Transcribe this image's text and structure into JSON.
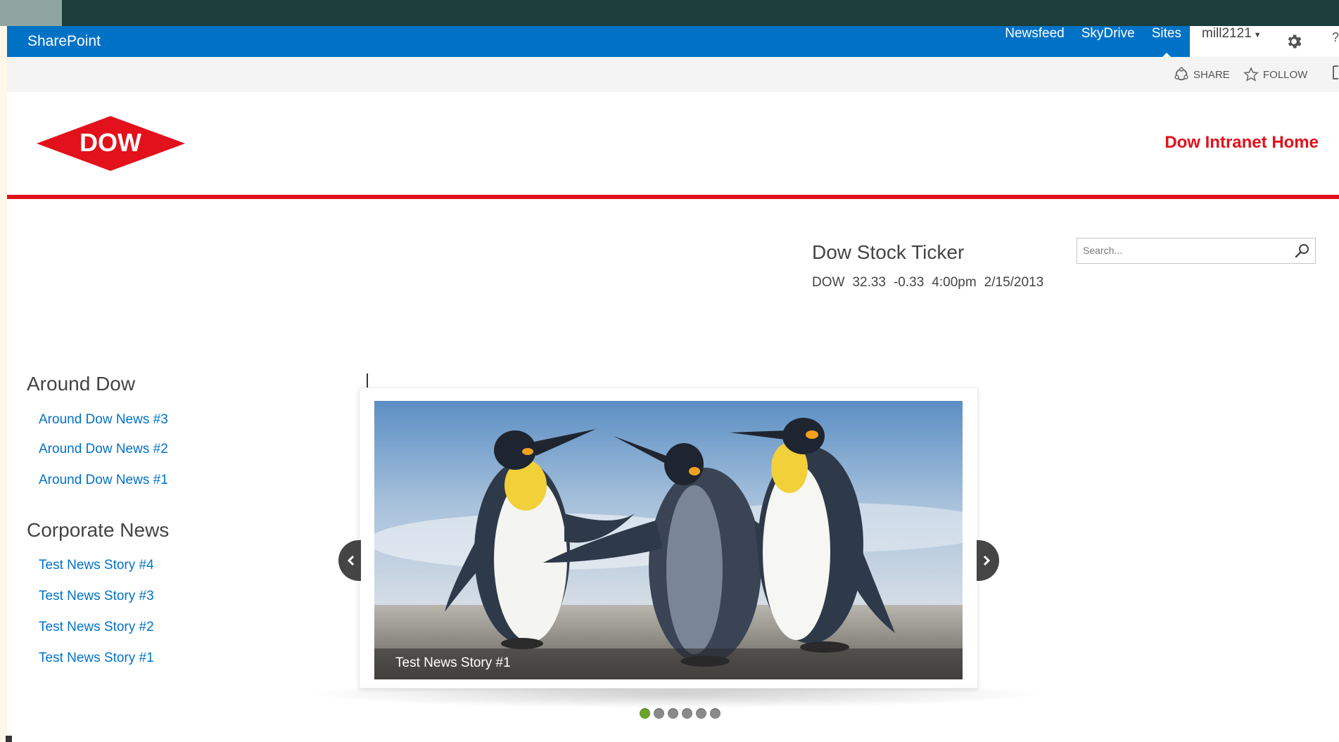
{
  "suite_bar": {
    "brand": "SharePoint",
    "links": [
      "Newsfeed",
      "SkyDrive",
      "Sites"
    ],
    "active_link": "Sites",
    "user": "mill2121",
    "bg_color": "#0072c6"
  },
  "ribbon": {
    "share_label": "SHARE",
    "follow_label": "FOLLOW"
  },
  "header": {
    "logo_text": "DOW",
    "logo_registered": "®",
    "site_title": "Dow Intranet Home",
    "accent_color": "#e2111b"
  },
  "stock_ticker": {
    "title": "Dow Stock Ticker",
    "symbol": "DOW",
    "price": "32.33",
    "change": "-0.33",
    "time": "4:00pm",
    "date": "2/15/2013"
  },
  "search": {
    "placeholder": "Search..."
  },
  "around_dow": {
    "heading": "Around Dow",
    "items": [
      "Around Dow News #3",
      "Around Dow News #2",
      "Around Dow News #1"
    ]
  },
  "corporate_news": {
    "heading": "Corporate News",
    "items": [
      "Test News Story #4",
      "Test News Story #3",
      "Test News Story #2",
      "Test News Story #1"
    ]
  },
  "carousel": {
    "caption": "Test News Story #1",
    "slide_count": 6,
    "active_slide": 1,
    "image": "penguins-photo"
  }
}
